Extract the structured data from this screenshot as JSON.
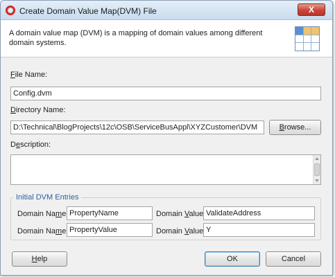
{
  "window": {
    "title": "Create Domain Value Map(DVM) File",
    "close_label": "X"
  },
  "header": {
    "description": "A domain value map (DVM) is a mapping of domain values among different domain systems."
  },
  "file_name": {
    "label_mnemonic": "F",
    "label_rest": "ile Name:",
    "value": "Config.dvm"
  },
  "directory_name": {
    "label_mnemonic": "D",
    "label_rest": "irectory Name:",
    "value": "D:\\Technical\\BlogProjects\\12c\\OSB\\ServiceBusAppl\\XYZCustomer\\DVM",
    "browse_mnemonic": "B",
    "browse_rest": "rowse..."
  },
  "description": {
    "label_prefix": "D",
    "label_mnemonic": "e",
    "label_rest": "scription:",
    "value": ""
  },
  "initial_entries": {
    "group_title": "Initial DVM Entries",
    "rows": [
      {
        "name_label_prefix": "Domain Na",
        "name_label_mnemonic": "m",
        "name_label_rest": "e:",
        "name_value": "PropertyName",
        "value_label_prefix": "Domain ",
        "value_label_mnemonic": "V",
        "value_label_rest": "alue:",
        "value_value": "ValidateAddress"
      },
      {
        "name_label_prefix": "Domain Na",
        "name_label_mnemonic": "m",
        "name_label_rest": "e:",
        "name_value": "PropertyValue",
        "value_label_prefix": "Domain ",
        "value_label_mnemonic": "V",
        "value_label_rest": "alue:",
        "value_value": "Y"
      }
    ]
  },
  "buttons": {
    "help_mnemonic": "H",
    "help_rest": "elp",
    "ok": "OK",
    "cancel": "Cancel"
  }
}
